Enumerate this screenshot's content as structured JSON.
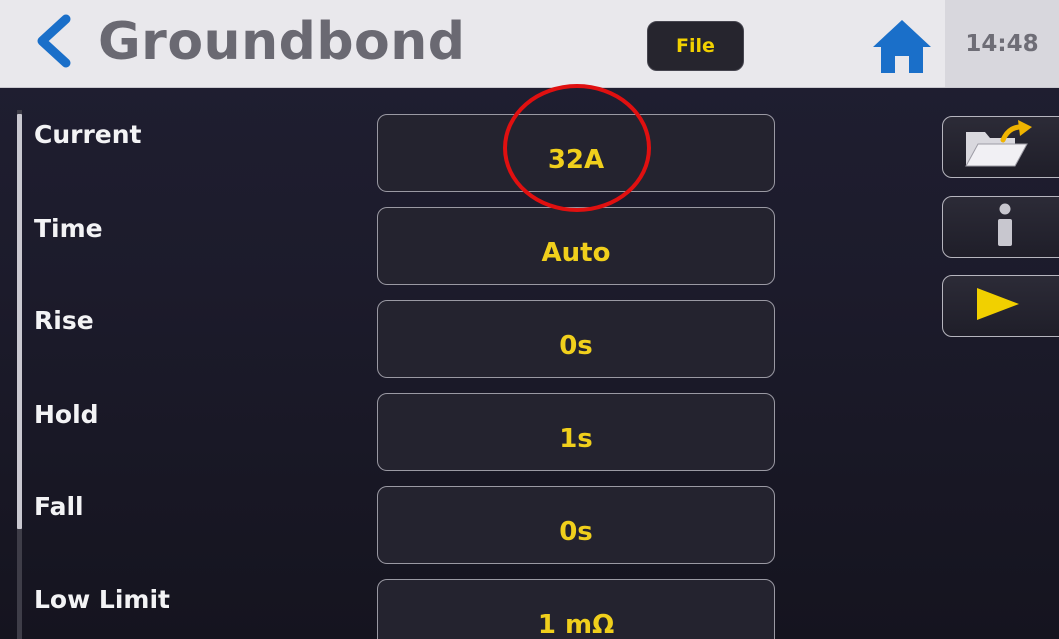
{
  "header": {
    "title": "Groundbond",
    "file_label": "File",
    "clock": "14:48"
  },
  "icons": {
    "back": "chevron-left-icon",
    "home": "home-icon",
    "open_folder": "folder-open-export-icon",
    "info": "info-icon",
    "start": "play-icon"
  },
  "params": [
    {
      "label": "Current",
      "value": "32A"
    },
    {
      "label": "Time",
      "value": "Auto"
    },
    {
      "label": "Rise",
      "value": "0s"
    },
    {
      "label": "Hold",
      "value": "1s"
    },
    {
      "label": "Fall",
      "value": "0s"
    },
    {
      "label": "Low Limit",
      "value": "1 mΩ"
    }
  ],
  "colors": {
    "accent_blue": "#1a6fc9",
    "value_yellow": "#f0cf1c",
    "highlight_red": "#e01010"
  }
}
